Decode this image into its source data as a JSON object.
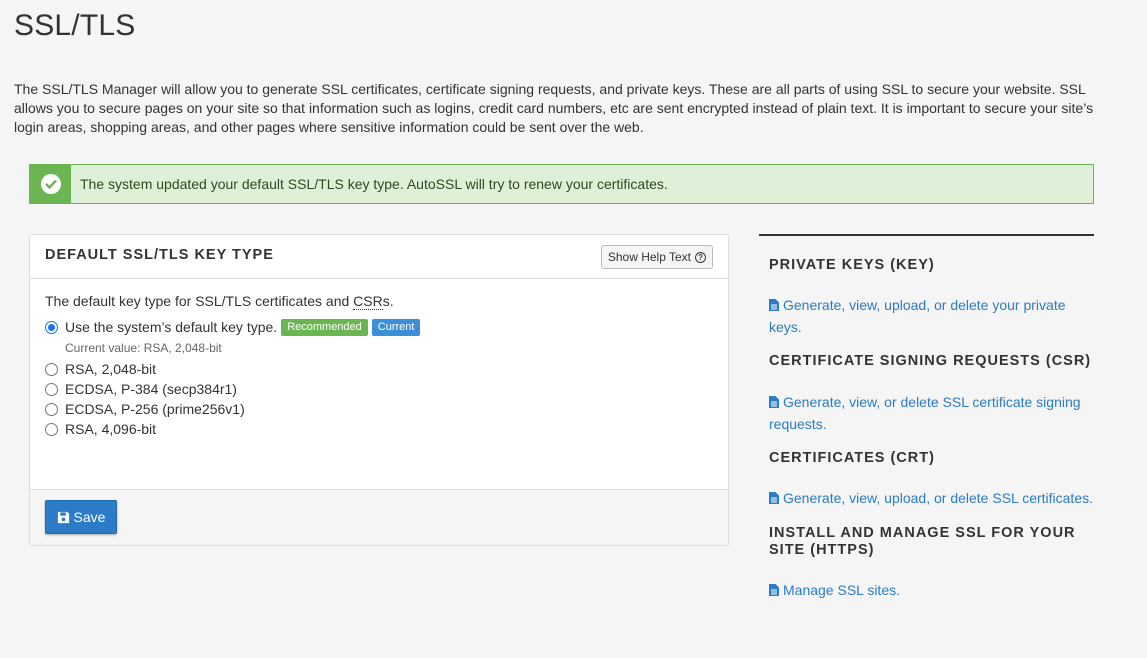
{
  "page": {
    "title": "SSL/TLS",
    "intro": "The SSL/TLS Manager will allow you to generate SSL certificates, certificate signing requests, and private keys. These are all parts of using SSL to secure your website. SSL allows you to secure pages on your site so that information such as logins, credit card numbers, etc are sent encrypted instead of plain text. It is important to secure your site’s login areas, shopping areas, and other pages where sensitive information could be sent over the web."
  },
  "alert": {
    "text": "The system updated your default SSL/TLS key type. AutoSSL will try to renew your certificates.",
    "icon": "check-circle-icon",
    "color": "#6bb552"
  },
  "panel": {
    "title": "DEFAULT SSL/TLS KEY TYPE",
    "help_button": "Show Help Text",
    "description_prefix": "The default key type for SSL/TLS certificates and ",
    "description_abbr": "CSR",
    "description_suffix": "s.",
    "default_option": {
      "label": "Use the system’s default key type.",
      "badge_recommended": "Recommended",
      "badge_current": "Current",
      "current_value": "Current value: RSA, 2,048-bit",
      "selected": true
    },
    "options": [
      {
        "label": "RSA, 2,048-bit"
      },
      {
        "label": "ECDSA, P-384 (secp384r1)"
      },
      {
        "label": "ECDSA, P-256 (prime256v1)"
      },
      {
        "label": "RSA, 4,096-bit"
      }
    ],
    "save_label": "Save"
  },
  "sidebar": {
    "sections": [
      {
        "heading": "PRIVATE KEYS (KEY)",
        "link": "Generate, view, upload, or delete your private keys."
      },
      {
        "heading": "CERTIFICATE SIGNING REQUESTS (CSR)",
        "link": "Generate, view, or delete SSL certificate signing requests."
      },
      {
        "heading": "CERTIFICATES (CRT)",
        "link": "Generate, view, upload, or delete SSL certificates."
      },
      {
        "heading": "INSTALL AND MANAGE SSL FOR YOUR SITE (HTTPS)",
        "link": "Manage SSL sites."
      }
    ]
  },
  "colors": {
    "link": "#2b7bc6",
    "success": "#6bb552",
    "primary_button": "#2b7bc6"
  }
}
